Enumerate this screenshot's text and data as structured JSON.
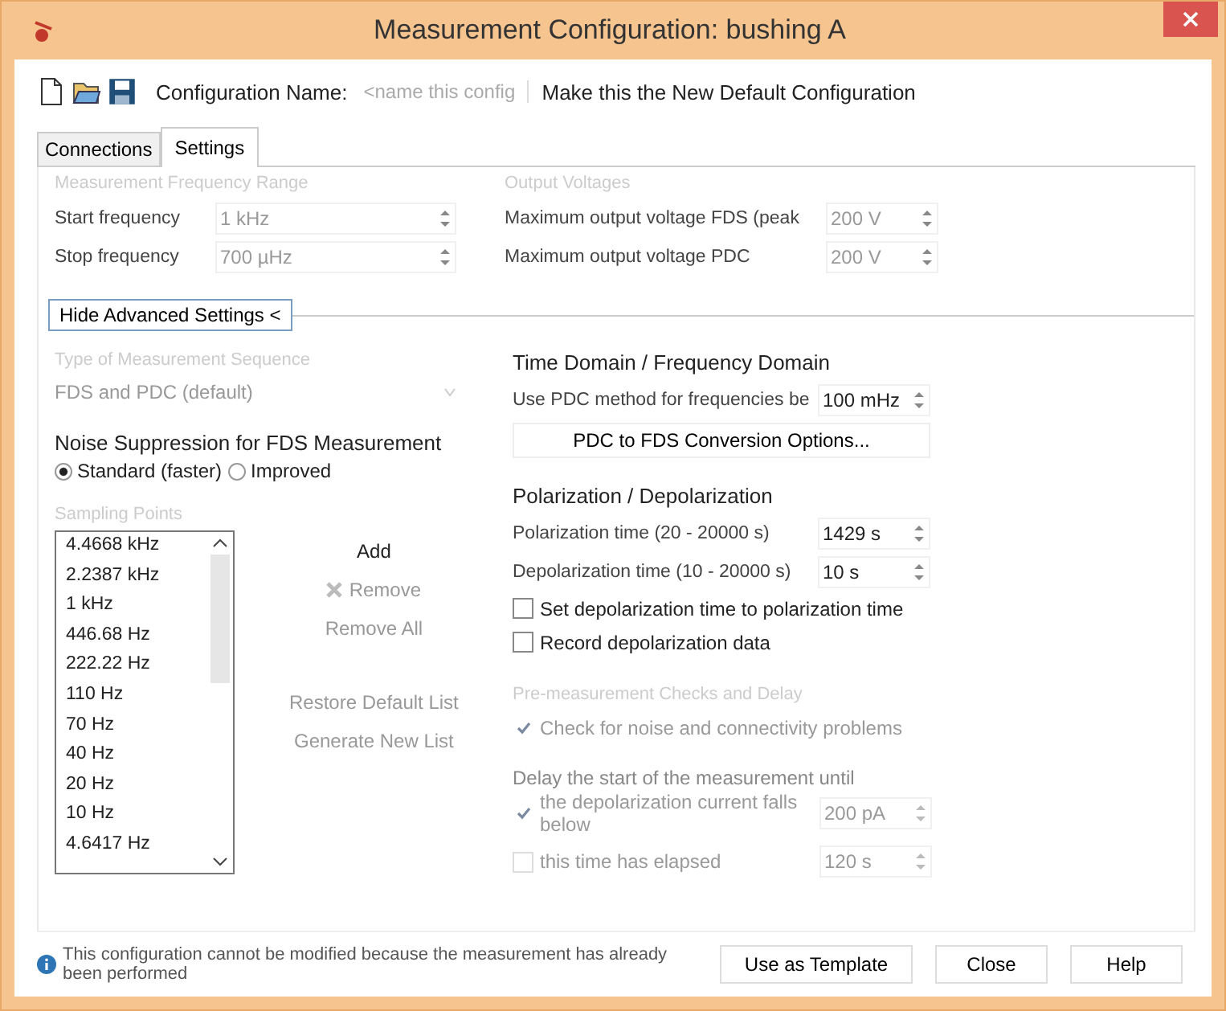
{
  "window": {
    "title": "Measurement Configuration: bushing A"
  },
  "toolbar": {
    "name_label": "Configuration Name:",
    "name_placeholder": "<name this config",
    "default_link": "Make this the New Default Configuration"
  },
  "tabs": [
    {
      "label": "Connections",
      "selected": false
    },
    {
      "label": "Settings",
      "selected": true
    }
  ],
  "frequency_range": {
    "caption": "Measurement Frequency Range",
    "rows": [
      {
        "label": "Start frequency",
        "value": "1 kHz",
        "disabled": true
      },
      {
        "label": "Stop frequency",
        "value": "700 µHz",
        "disabled": true
      }
    ]
  },
  "output_voltages": {
    "caption": "Output Voltages",
    "rows": [
      {
        "label": "Maximum output voltage FDS (peak",
        "value": "200 V",
        "disabled": true
      },
      {
        "label": "Maximum output voltage PDC",
        "value": "200 V",
        "disabled": true
      }
    ]
  },
  "advanced_toggle": "Hide Advanced Settings <",
  "sequence": {
    "caption": "Type of Measurement Sequence",
    "value": "FDS and PDC (default)",
    "disabled": true
  },
  "noise": {
    "title": "Noise Suppression for FDS Measurement",
    "options": [
      {
        "label": "Standard (faster)",
        "selected": true
      },
      {
        "label": "Improved",
        "selected": false
      }
    ]
  },
  "sampling": {
    "caption": "Sampling Points",
    "items": [
      "4.4668 kHz",
      "2.2387 kHz",
      "1 kHz",
      "446.68 Hz",
      "222.22 Hz",
      "110 Hz",
      "70 Hz",
      "40 Hz",
      "20 Hz",
      "10 Hz",
      "4.6417 Hz"
    ],
    "actions": [
      {
        "label": "Add",
        "disabled": false,
        "kind": "plain"
      },
      {
        "label": "Remove",
        "disabled": true,
        "kind": "icon"
      },
      {
        "label": "Remove All",
        "disabled": true,
        "kind": "plain"
      },
      {
        "label": "Restore Default List",
        "disabled": true,
        "kind": "spaced"
      },
      {
        "label": "Generate New List",
        "disabled": true,
        "kind": "plain"
      }
    ]
  },
  "time_domain": {
    "title": "Time Domain / Frequency Domain",
    "pdc_row": {
      "label": "Use PDC method for frequencies be",
      "value": "100 mHz",
      "disabled": false
    },
    "conversion_button": "PDC to FDS Conversion Options..."
  },
  "polarization": {
    "title": "Polarization / Depolarization",
    "rows": [
      {
        "label": "Polarization time (20 - 20000 s)",
        "value": "1429 s",
        "disabled": false
      },
      {
        "label": "Depolarization time (10 - 20000 s)",
        "value": "10 s",
        "disabled": false
      }
    ],
    "checks": [
      {
        "label": "Set depolarization time to polarization time",
        "checked": false
      },
      {
        "label": "Record depolarization data",
        "checked": false
      }
    ]
  },
  "pre_checks": {
    "caption": "Pre-measurement Checks and Delay",
    "noise_check": {
      "label": "Check for noise and connectivity problems",
      "checked": true,
      "disabled": true
    },
    "delay_caption": "Delay the start of the measurement until",
    "delay_rows": [
      {
        "label": "the depolarization current falls below",
        "value": "200 pA",
        "checked": true
      },
      {
        "label": "this time has elapsed",
        "value": "120 s",
        "checked": false
      }
    ]
  },
  "footer": {
    "message": "This configuration cannot be modified because the measurement has already been performed",
    "buttons": [
      "Use as Template",
      "Close",
      "Help"
    ]
  }
}
